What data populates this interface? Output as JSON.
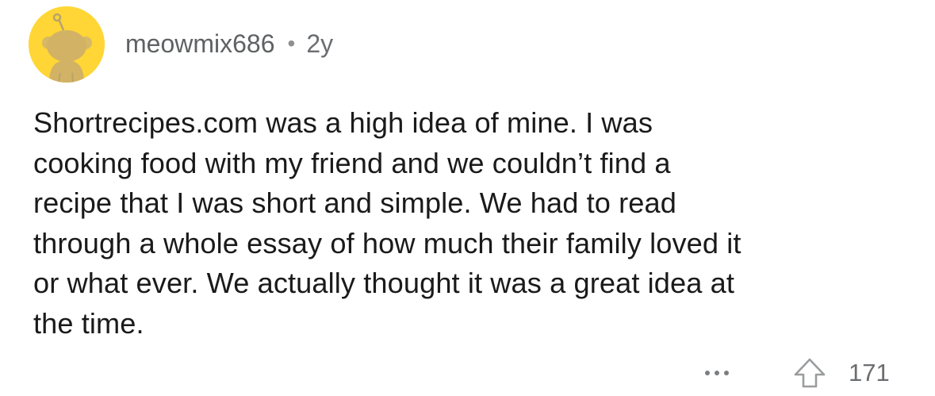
{
  "comment": {
    "author": "meowmix686",
    "separator": "•",
    "age": "2y",
    "avatar_icon": "snoo-avatar-icon",
    "avatar_color": "#ffd635",
    "lines": [
      "Shortrecipes.com was a high idea of mine. I was",
      "cooking food with my friend and we couldn’t find a",
      "recipe that I was short and simple. We had to read",
      "through a whole essay of how much their family loved it",
      "or what ever. We actually thought it was a great idea at",
      "the time."
    ],
    "actions": {
      "more_icon": "ellipsis-icon",
      "upvote_icon": "upvote-arrow-icon",
      "score": "171"
    }
  }
}
